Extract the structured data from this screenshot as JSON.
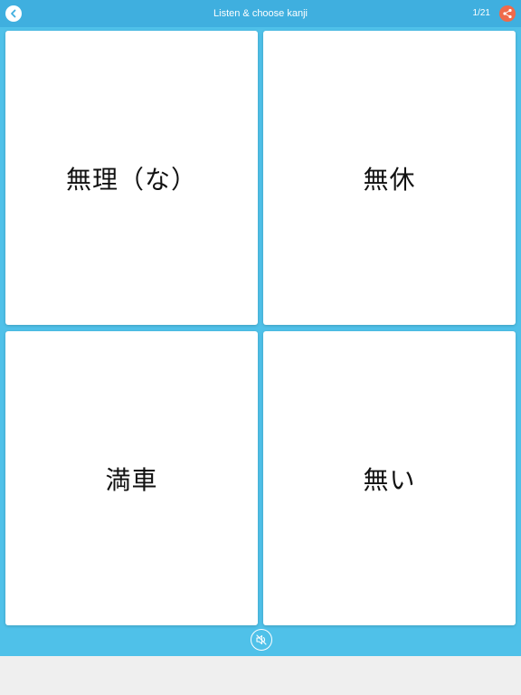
{
  "header": {
    "title": "Listen & choose kanji",
    "progress": "1/21",
    "back_icon": "chevron-left-icon",
    "share_icon": "share-icon"
  },
  "choices": [
    {
      "label": "無理（な）"
    },
    {
      "label": "無休"
    },
    {
      "label": "満車"
    },
    {
      "label": "無い"
    }
  ],
  "footer": {
    "sound_icon": "sound-off-icon"
  },
  "colors": {
    "header_bg": "#3fafdf",
    "app_bg": "#4fc1e9",
    "share_accent": "#ef6a4a",
    "card_bg": "#ffffff"
  }
}
